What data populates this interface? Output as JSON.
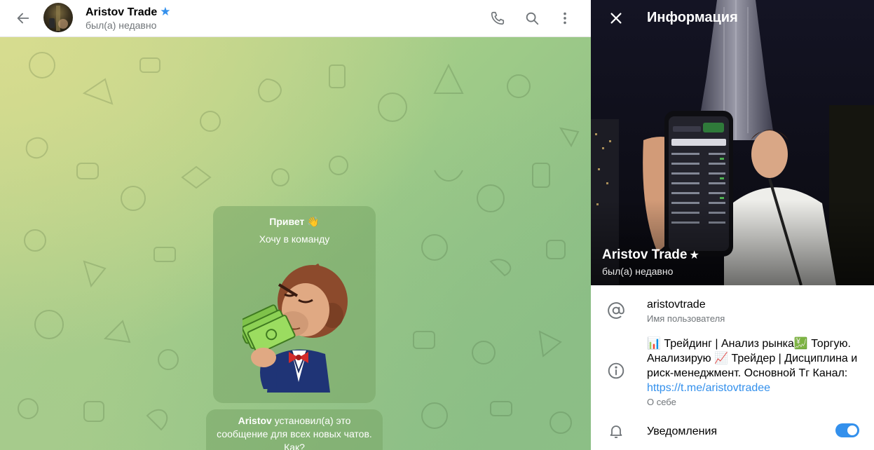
{
  "chat": {
    "title": "Aristov Trade",
    "status": "был(а) недавно",
    "message": {
      "greeting": "Привет 👋",
      "text": "Хочу в команду",
      "sticker": "monkey-money-sticker"
    },
    "system_message": {
      "author": "Aristov",
      "text": "установил(а) это сообщение для всех новых чатов. Как?"
    }
  },
  "info_panel": {
    "title": "Информация",
    "profile_name": "Aristov Trade",
    "profile_status": "был(а) недавно",
    "username": "aristovtrade",
    "username_label": "Имя пользователя",
    "bio_text": "📊 Трейдинг | Анализ рынка💹 Торгую. Анализирую 📈 Трейдер | Дисциплина и риск-менеджмент. Основной Тг Канал:",
    "bio_link": "https://t.me/aristovtradee",
    "bio_label": "О себе",
    "notifications_label": "Уведомления",
    "notifications_enabled": true
  },
  "icons": {
    "back": "arrow-left-icon",
    "call": "phone-icon",
    "search": "search-icon",
    "more": "more-vertical-icon",
    "close": "close-icon",
    "username": "at-sign-icon",
    "bio": "info-icon",
    "notifications": "bell-icon",
    "verified": "star-icon"
  },
  "colors": {
    "accent": "#3390ec",
    "secondary_text": "#707579",
    "bubble": "#78a666"
  }
}
